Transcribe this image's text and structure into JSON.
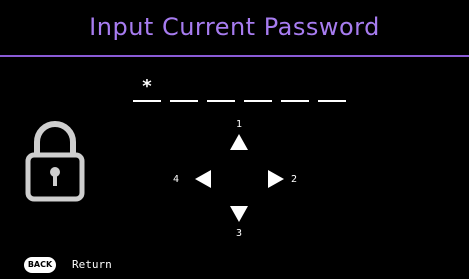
{
  "header": {
    "title": "Input Current Password"
  },
  "password": {
    "slots": [
      "*",
      "",
      "",
      "",
      "",
      ""
    ]
  },
  "keypad": {
    "up_number": "1",
    "right_number": "2",
    "down_number": "3",
    "left_number": "4"
  },
  "footer": {
    "back_button_label": "BACK",
    "back_action_label": "Return"
  },
  "colors": {
    "title": "#a77cf0",
    "divider": "#8a5bd6",
    "background": "#000000",
    "foreground": "#ffffff",
    "lock": "#cfcfcf"
  },
  "icons": {
    "lock": "lock-icon",
    "up": "arrow-up-icon",
    "down": "arrow-down-icon",
    "left": "arrow-left-icon",
    "right": "arrow-right-icon"
  }
}
